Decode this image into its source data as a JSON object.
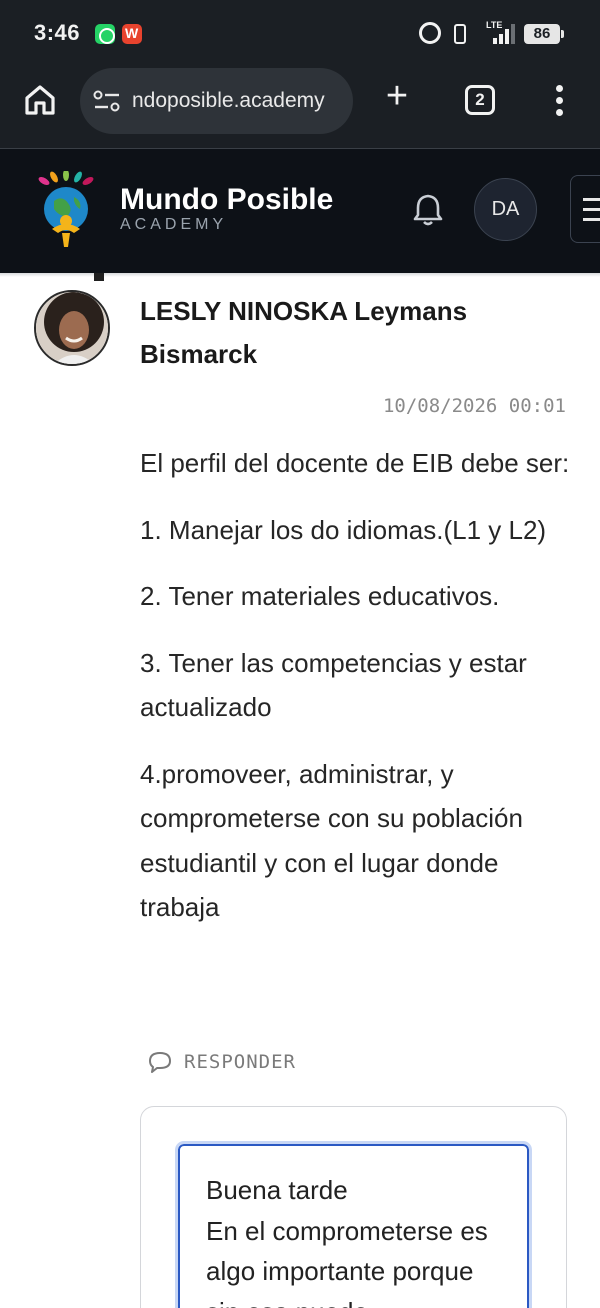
{
  "status_bar": {
    "time": "3:46",
    "network": "LTE",
    "battery": "86"
  },
  "browser": {
    "url": "ndoposible.academy",
    "tab_count": "2",
    "new_tab_symbol": "+",
    "icons": [
      "home-icon",
      "site-settings-icon",
      "plus-icon",
      "tabs-icon",
      "more-vertical-icon"
    ]
  },
  "site_header": {
    "brand_name": "Mundo Posible",
    "brand_sub": "ACADEMY",
    "user_initials": "DA",
    "colors": {
      "background": "#0d1117",
      "brand_text": "#ffffff"
    }
  },
  "comment": {
    "author": "LESLY NINOSKA Leymans Bismarck",
    "date": "10/08/2026 00:01",
    "paragraphs": [
      "El perfil del docente de EIB debe ser:",
      "1. Manejar los do idiomas.(L1 y L2)",
      "2. Tener materiales educativos.",
      "3. Tener las competencias y estar actualizado",
      "4.promoveer, administrar, y comprometerse con su población estudiantil y con el lugar donde trabaja"
    ],
    "reply_label": "RESPONDER"
  },
  "reply_box": {
    "value": "Buena tarde\nEn el comprometerse es algo importante porque sin eso puede",
    "focus_color": "#2b59c3"
  }
}
